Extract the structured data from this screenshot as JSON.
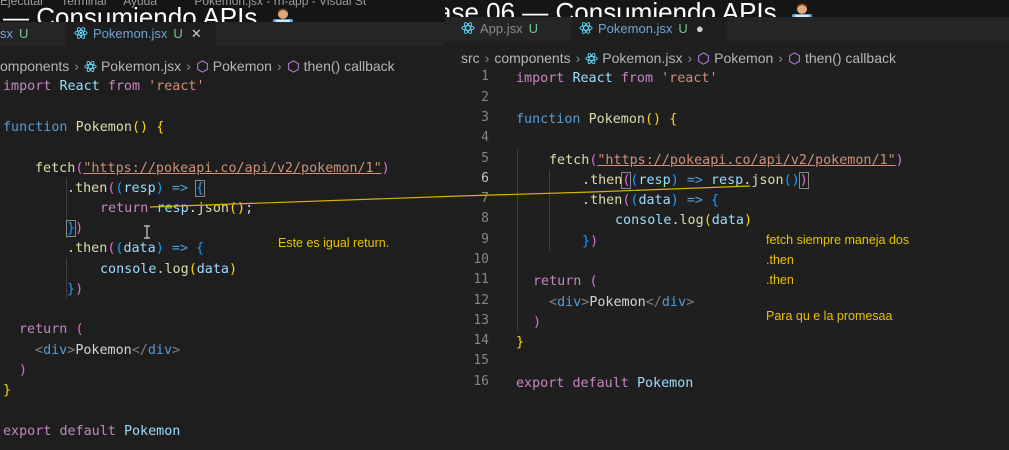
{
  "left": {
    "menu": [
      "Ejecutar",
      "Terminal",
      "Ayuda",
      "Pokemon.jsx - rn-app - Visual St"
    ],
    "title": "— Consumiendo APIs",
    "tabs": [
      {
        "label": "sx",
        "status": "U"
      },
      {
        "label": "Pokemon.jsx",
        "status": "U",
        "close": "✕"
      }
    ],
    "breadcrumb": [
      "omponents",
      "Pokemon.jsx",
      "Pokemon",
      "then() callback"
    ],
    "annotation": "Este es igual return."
  },
  "right": {
    "title": "ase 06 — Consumiendo APIs",
    "tabs": [
      {
        "label": "App.jsx",
        "status": "U"
      },
      {
        "label": "Pokemon.jsx",
        "status": "U",
        "dot": "●"
      }
    ],
    "breadcrumb": [
      "src",
      "components",
      "Pokemon.jsx",
      "Pokemon",
      "then() callback"
    ],
    "line_numbers": [
      "1",
      "2",
      "3",
      "4",
      "5",
      "6",
      "7",
      "8",
      "9",
      "10",
      "11",
      "12",
      "13",
      "14",
      "15",
      "16"
    ],
    "annotation": {
      "line1": "fetch  siempre maneja dos",
      "line2": ".then",
      "line3": ".then",
      "line4": "Para qu e la promesaa"
    }
  },
  "code": {
    "import": "import",
    "react": "React",
    "from": "from",
    "react_str": "'react'",
    "function": "function",
    "component": "Pokemon",
    "fetch": "fetch",
    "url": "\"https://pokeapi.co/api/v2/pokemon/1\"",
    "then": "then",
    "resp": "resp",
    "data": "data",
    "return": "return",
    "json": "json",
    "console": "console",
    "log": "log",
    "div": "div",
    "export": "export",
    "default": "default",
    "arrow": "=>"
  }
}
